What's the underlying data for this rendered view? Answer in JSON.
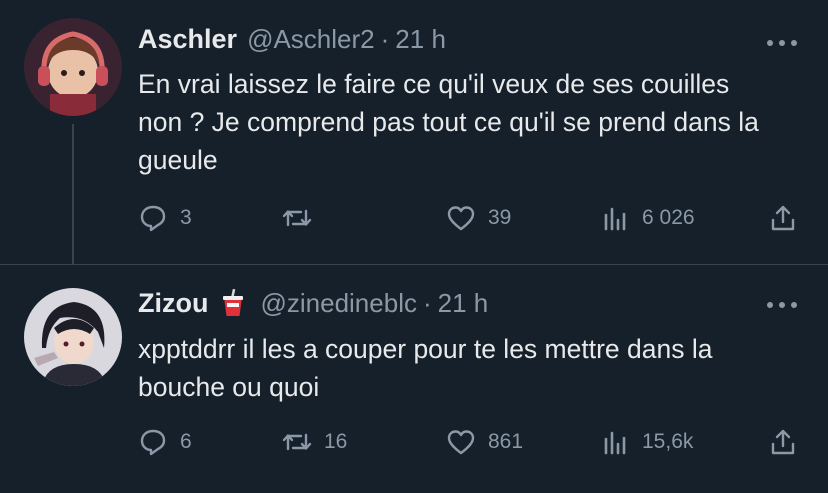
{
  "colors": {
    "background": "#15202b",
    "text": "#e7e9ea",
    "secondary": "#8b98a5",
    "divider": "#38444d"
  },
  "tweets": [
    {
      "display_name": "Aschler",
      "handle": "@Aschler2",
      "separator": "·",
      "time": "21 h",
      "text": "En vrai laissez le faire ce qu'il veux de ses couilles non ? Je comprend pas tout ce qu'il se prend dans la gueule",
      "avatar_icon": "avatar-headphones-character",
      "counts": {
        "replies": "3",
        "retweets": "",
        "likes": "39",
        "views": "6 026"
      }
    },
    {
      "display_name": "Zizou",
      "name_emoji_icon": "cup-with-straw-icon",
      "handle": "@zinedineblc",
      "separator": "·",
      "time": "21 h",
      "text": "xpptddrr il les a couper pour te les mettre dans la bouche ou quoi",
      "avatar_icon": "avatar-anime-character",
      "counts": {
        "replies": "6",
        "retweets": "16",
        "likes": "861",
        "views": "15,6k"
      }
    }
  ]
}
